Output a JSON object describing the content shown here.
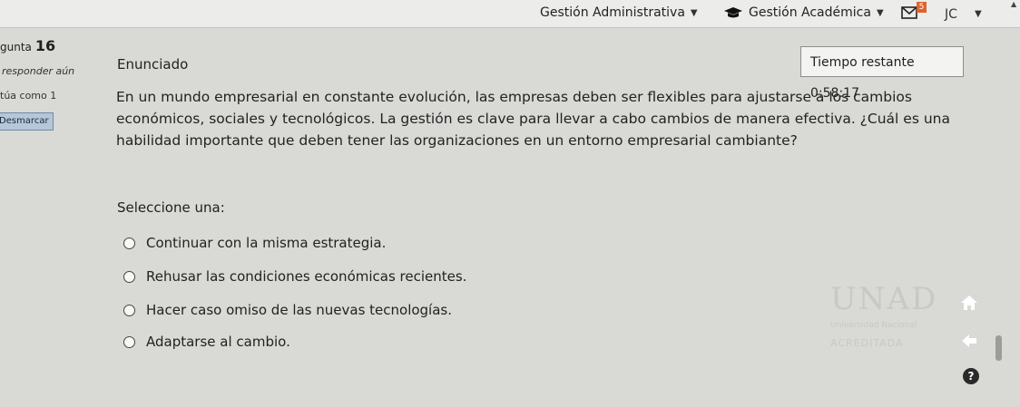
{
  "topbar": {
    "menu_admin": "Gestión Administrativa",
    "menu_academic": "Gestión Académica",
    "messages_count": "5",
    "user_initials": "JC"
  },
  "question_info": {
    "title_prefix": "gunta",
    "number": "16",
    "status": "responder aún",
    "score": "túa como 1",
    "flag_label": "Desmarcar"
  },
  "main": {
    "enunciado_label": "Enunciado",
    "timer_label": "Tiempo restante",
    "timer_value": "0:58:17",
    "question_text": "En un mundo empresarial en constante evolución, las empresas deben ser flexibles para ajustarse a los cambios económicos, sociales y tecnológicos. La gestión es clave para llevar a cabo cambios de manera efectiva. ¿Cuál es una habilidad importante que deben tener las organizaciones en un entorno empresarial cambiante?",
    "select_prompt": "Seleccione una:",
    "options": [
      "Continuar con la misma estrategia.",
      "Rehusar las condiciones económicas recientes.",
      "Hacer caso omiso de las nuevas tecnologías.",
      "Adaptarse al cambio."
    ]
  },
  "logo": {
    "name": "UNAD",
    "subtitle": "Universidad Nacional",
    "accreditation": "ACREDITADA"
  },
  "colors": {
    "flag_button": "#b5c7d9",
    "badge": "#e0622d"
  },
  "icons": [
    "chevron-down-icon",
    "graduation-cap-icon",
    "message-icon",
    "home-icon",
    "arrow-left-icon",
    "help-icon"
  ]
}
